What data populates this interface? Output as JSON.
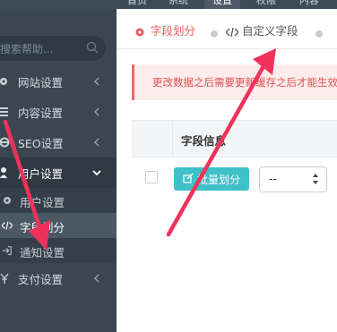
{
  "top_nav": {
    "items": [
      {
        "label": "首页",
        "active": false
      },
      {
        "label": "系统",
        "active": false
      },
      {
        "label": "设置",
        "active": true
      },
      {
        "label": "权限",
        "active": false
      },
      {
        "label": "内容",
        "active": false
      }
    ]
  },
  "sidebar": {
    "search_placeholder": "搜索帮助...",
    "search_icon": "search-icon",
    "menu": [
      {
        "label": "网站设置",
        "icon": "gear-icon"
      },
      {
        "label": "内容设置",
        "icon": "list-icon"
      },
      {
        "label": "SEO设置",
        "icon": "ie-icon"
      },
      {
        "label": "用户设置",
        "icon": "user-icon",
        "open": true
      }
    ],
    "submenu": [
      {
        "label": "用户设置",
        "icon": "gear-icon"
      },
      {
        "label": "字段划分",
        "icon": "code-icon",
        "active": true
      },
      {
        "label": "通知设置",
        "icon": "login-icon"
      }
    ],
    "after": [
      {
        "label": "支付设置",
        "icon": "yen-icon"
      }
    ]
  },
  "content": {
    "tabs": [
      {
        "label": "字段划分",
        "icon": "gear-icon",
        "active": true
      },
      {
        "label": "自定义字段",
        "icon": "code-icon",
        "active": false
      }
    ],
    "alert_text": "更改数据之后需要更新缓存之后才能生效",
    "table": {
      "header_label": "字段信息"
    },
    "batch_button_label": "批量划分",
    "select_value": "--"
  },
  "colors": {
    "sidebar_bg": "#3b4651",
    "accent": "#3fc1c9",
    "active_tab": "#e65b5b",
    "annotation_arrow": "#f0325a"
  }
}
